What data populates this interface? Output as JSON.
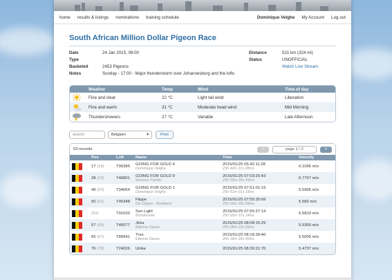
{
  "nav": {
    "home": "home",
    "results": "results & listings",
    "nominations": "nominations",
    "schedule": "training schedule",
    "user": "Dominique Velghe",
    "account": "My Account",
    "logout": "Log out"
  },
  "race": {
    "title": "South African Million Dollar Pigeon Race",
    "date_label": "Date",
    "date": "24 Jan 2015, 06:00",
    "type_label": "Type",
    "basketed_label": "Basketed",
    "basketed": "2453 Pigeons",
    "notes_label": "Notes",
    "notes": "Sunday - 17:00 - Major thunderstorm over Johannesburg and the lofts",
    "distance_label": "Distance",
    "distance": "521 km (324 mi)",
    "status_label": "Status",
    "status": "UNOFFICIAL",
    "watch": "Watch Live Stream"
  },
  "weather": {
    "headers": [
      "Weather",
      "Temp",
      "Wind",
      "Time of day"
    ],
    "rows": [
      {
        "icon": "sun-icon",
        "weather": "Fine and clear",
        "temp": "22 °C",
        "wind": "Light tail wind",
        "time": "Liberation"
      },
      {
        "icon": "sun-cloud-icon",
        "weather": "Fine and warm",
        "temp": "31 °C",
        "wind": "Moderate head wind",
        "time": "Mid Morning"
      },
      {
        "icon": "thunder-cloud-icon",
        "weather": "Thundershowers",
        "temp": "27 °C",
        "wind": "Variable",
        "time": "Late Afternoon"
      }
    ]
  },
  "filters": {
    "search_placeholder": "search",
    "country": "Belgium",
    "print": "Print"
  },
  "results": {
    "count": "53 records",
    "prev": "<",
    "next": ">",
    "page": "page 1 / 2",
    "headers": [
      "Pos",
      "Loft",
      "Name",
      "Time",
      "Velocity"
    ],
    "rows": [
      {
        "pos": "17",
        "rank": "(18)",
        "loft": "T90385",
        "name": "GOING FOR GOLD 4",
        "owner": "Dominique Velghe",
        "time": "2015/01/25 05:42:11:28",
        "elapsed": "23h 42m 11s 28ms",
        "velocity": "6.1056 m/s"
      },
      {
        "pos": "28",
        "rank": "(29)",
        "loft": "T46801",
        "name": "GOING FOR GOLD 9",
        "owner": "Wouters Family",
        "time": "2015/01/25 07:03:25:43",
        "elapsed": "25h 03m 25s 43ms",
        "velocity": "5.7757 m/s"
      },
      {
        "pos": "49",
        "rank": "(50)",
        "loft": "T94064",
        "name": "GOING FOR GOLD 1",
        "owner": "Dominique Velghe",
        "time": "2015/01/25 07:51:01:19",
        "elapsed": "25h 51m 01s 19ms",
        "velocity": "5.5965 m/s"
      },
      {
        "pos": "50",
        "rank": "(51)",
        "loft": "T45348",
        "name": "Flippe",
        "owner": "De Clipper - Boddaert",
        "time": "2015/01/25 07:55:35:69",
        "elapsed": "25h 55m 35s 69ms",
        "velocity": "5.582 m/s"
      },
      {
        "pos": "",
        "rank": "(52)",
        "loft": "T91020",
        "name": "Sun Light",
        "owner": "Bondervoet",
        "time": "2015/01/25 07:55:37:14",
        "elapsed": "25h 55m 37s 14ms",
        "velocity": "5.5819 m/s"
      },
      {
        "pos": "57",
        "rank": "(59)",
        "loft": "T46077",
        "name": "Jirka",
        "owner": "Etienne Devos",
        "time": "2015/01/25 08:08:15:29",
        "elapsed": "26h 08m 15s 29ms",
        "velocity": "5.5369 m/s"
      },
      {
        "pos": "65",
        "rank": "(67)",
        "loft": "T89941",
        "name": "Tres",
        "owner": "Etienne Devos",
        "time": "2015/01/25 08:18:39:40",
        "elapsed": "26h 18m 39s 40ms",
        "velocity": "5.5005 m/s"
      },
      {
        "pos": "76",
        "rank": "(78)",
        "loft": "T24026",
        "name": "Ulrike",
        "owner": "",
        "time": "2015/01/25 08:26:21:70",
        "elapsed": "",
        "velocity": "5.4737 m/s"
      }
    ]
  },
  "colors": {
    "accent": "#2f6ea3",
    "header": "#7f98ae",
    "row_alt": "#eaf1f7"
  }
}
